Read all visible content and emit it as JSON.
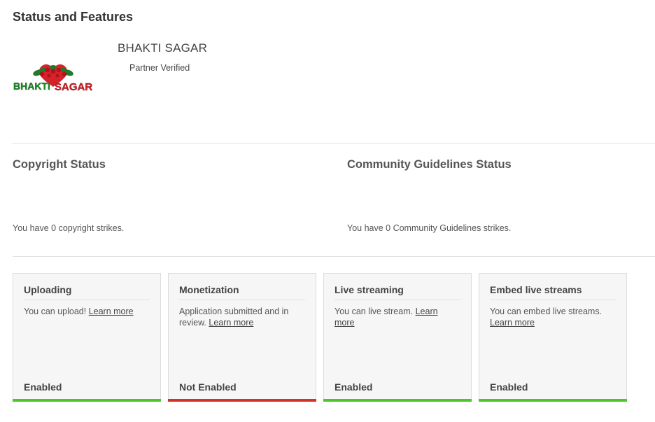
{
  "page": {
    "title": "Status and Features"
  },
  "channel": {
    "name": "BHAKTI SAGAR",
    "status": "Partner Verified",
    "logo_text_left": "BHAKTI",
    "logo_text_right": "SAGAR"
  },
  "copyright": {
    "title": "Copyright Status",
    "text": "You have 0 copyright strikes."
  },
  "community": {
    "title": "Community Guidelines Status",
    "text": "You have 0 Community Guidelines strikes."
  },
  "features": [
    {
      "title": "Uploading",
      "desc": "You can upload!",
      "link": "Learn more",
      "state": "Enabled",
      "bar_color": "#4cc72a"
    },
    {
      "title": "Monetization",
      "desc": "Application submitted and in review.",
      "link": "Learn more",
      "state": "Not Enabled",
      "bar_color": "#d5312b"
    },
    {
      "title": "Live streaming",
      "desc": "You can live stream.",
      "link": "Learn more",
      "state": "Enabled",
      "bar_color": "#4cc72a"
    },
    {
      "title": "Embed live streams",
      "desc": "You can embed live streams.",
      "link": "Learn more",
      "state": "Enabled",
      "bar_color": "#4cc72a"
    }
  ],
  "colors": {
    "enabled": "#4cc72a",
    "not_enabled": "#d5312b",
    "logo_heart": "#d5232b",
    "logo_green": "#1f8a2a"
  }
}
